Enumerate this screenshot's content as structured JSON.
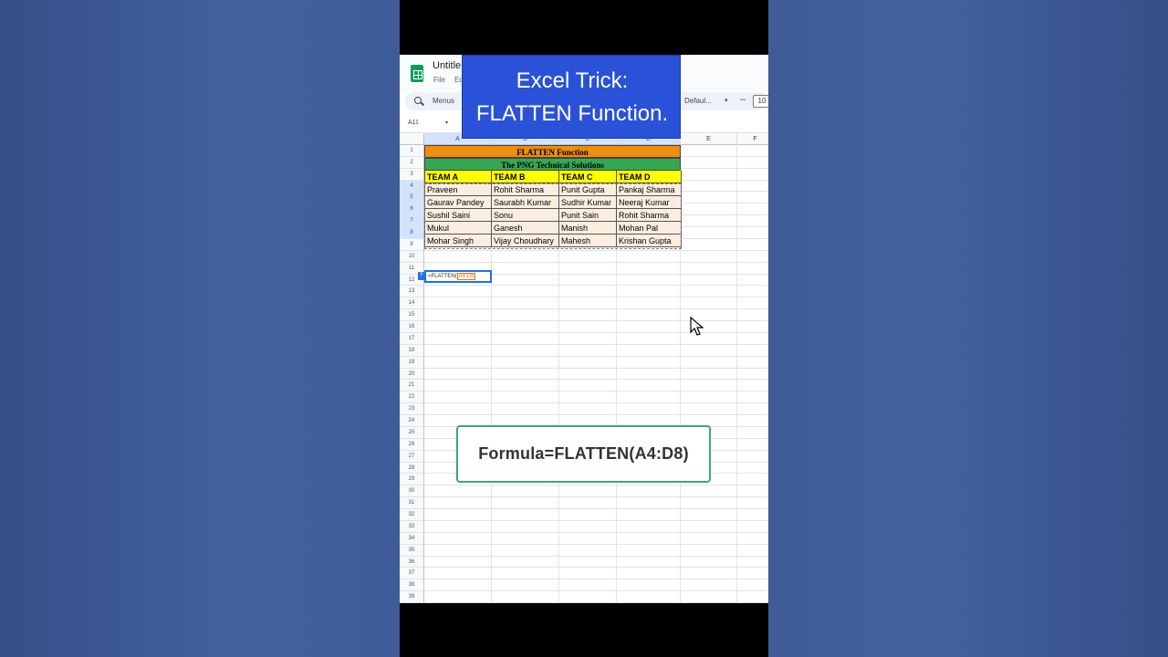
{
  "app": {
    "doc_title": "Untitle",
    "menu_file": "File",
    "menu_edit": "Ed"
  },
  "toolbar": {
    "search_label": "Menus",
    "font": "Defaul...",
    "minus": "–",
    "font_size": "10"
  },
  "name_box": "A11",
  "columns": [
    "A",
    "B",
    "C",
    "D",
    "E",
    "F"
  ],
  "rows": [
    "1",
    "2",
    "3",
    "4",
    "5",
    "6",
    "7",
    "8",
    "9",
    "10",
    "11",
    "12",
    "13",
    "14",
    "15",
    "16",
    "17",
    "18",
    "19",
    "20",
    "21",
    "22",
    "23",
    "24",
    "25",
    "26",
    "27",
    "28",
    "29",
    "30",
    "31",
    "32",
    "33",
    "34",
    "35",
    "36",
    "37",
    "38",
    "39"
  ],
  "sheet": {
    "title_row": "FLATTEN Function",
    "subtitle_row": "The PNG Technical Solutions",
    "headers": [
      "TEAM A",
      "TEAM B",
      "TEAM C",
      "TEAM D"
    ],
    "data": [
      [
        "Praveen",
        "Rohit Sharma",
        "Punit Gupta",
        "Pankaj Sharma"
      ],
      [
        "Gaurav Pandey",
        "Saurabh Kumar",
        "Sudhir Kumar",
        "Neeraj Kumar"
      ],
      [
        "Sushil Saini",
        "Sonu",
        "Punit Sain",
        "Rohit Sharma"
      ],
      [
        "Mukul",
        "Ganesh",
        "Manish",
        "Mohan Pal"
      ],
      [
        "Mohar Singh",
        "Vijay Choudhary",
        "Mahesh",
        "Krishan Gupta"
      ]
    ],
    "formula_prefix": "=FLATTEN(",
    "formula_ref": "A4:D8",
    "help_glyph": "?"
  },
  "overlay": {
    "banner_line1": "Excel Trick:",
    "banner_line2": "FLATTEN Function.",
    "formula_caption": "Formula=FLATTEN(A4:D8)"
  },
  "colors": {
    "title_band": "#ee8d0e",
    "subtitle_band": "#35a853",
    "header_fill": "#ffff00",
    "data_fill": "#fbeee0",
    "banner": "#2952d9",
    "caption_border": "#3aa676"
  }
}
